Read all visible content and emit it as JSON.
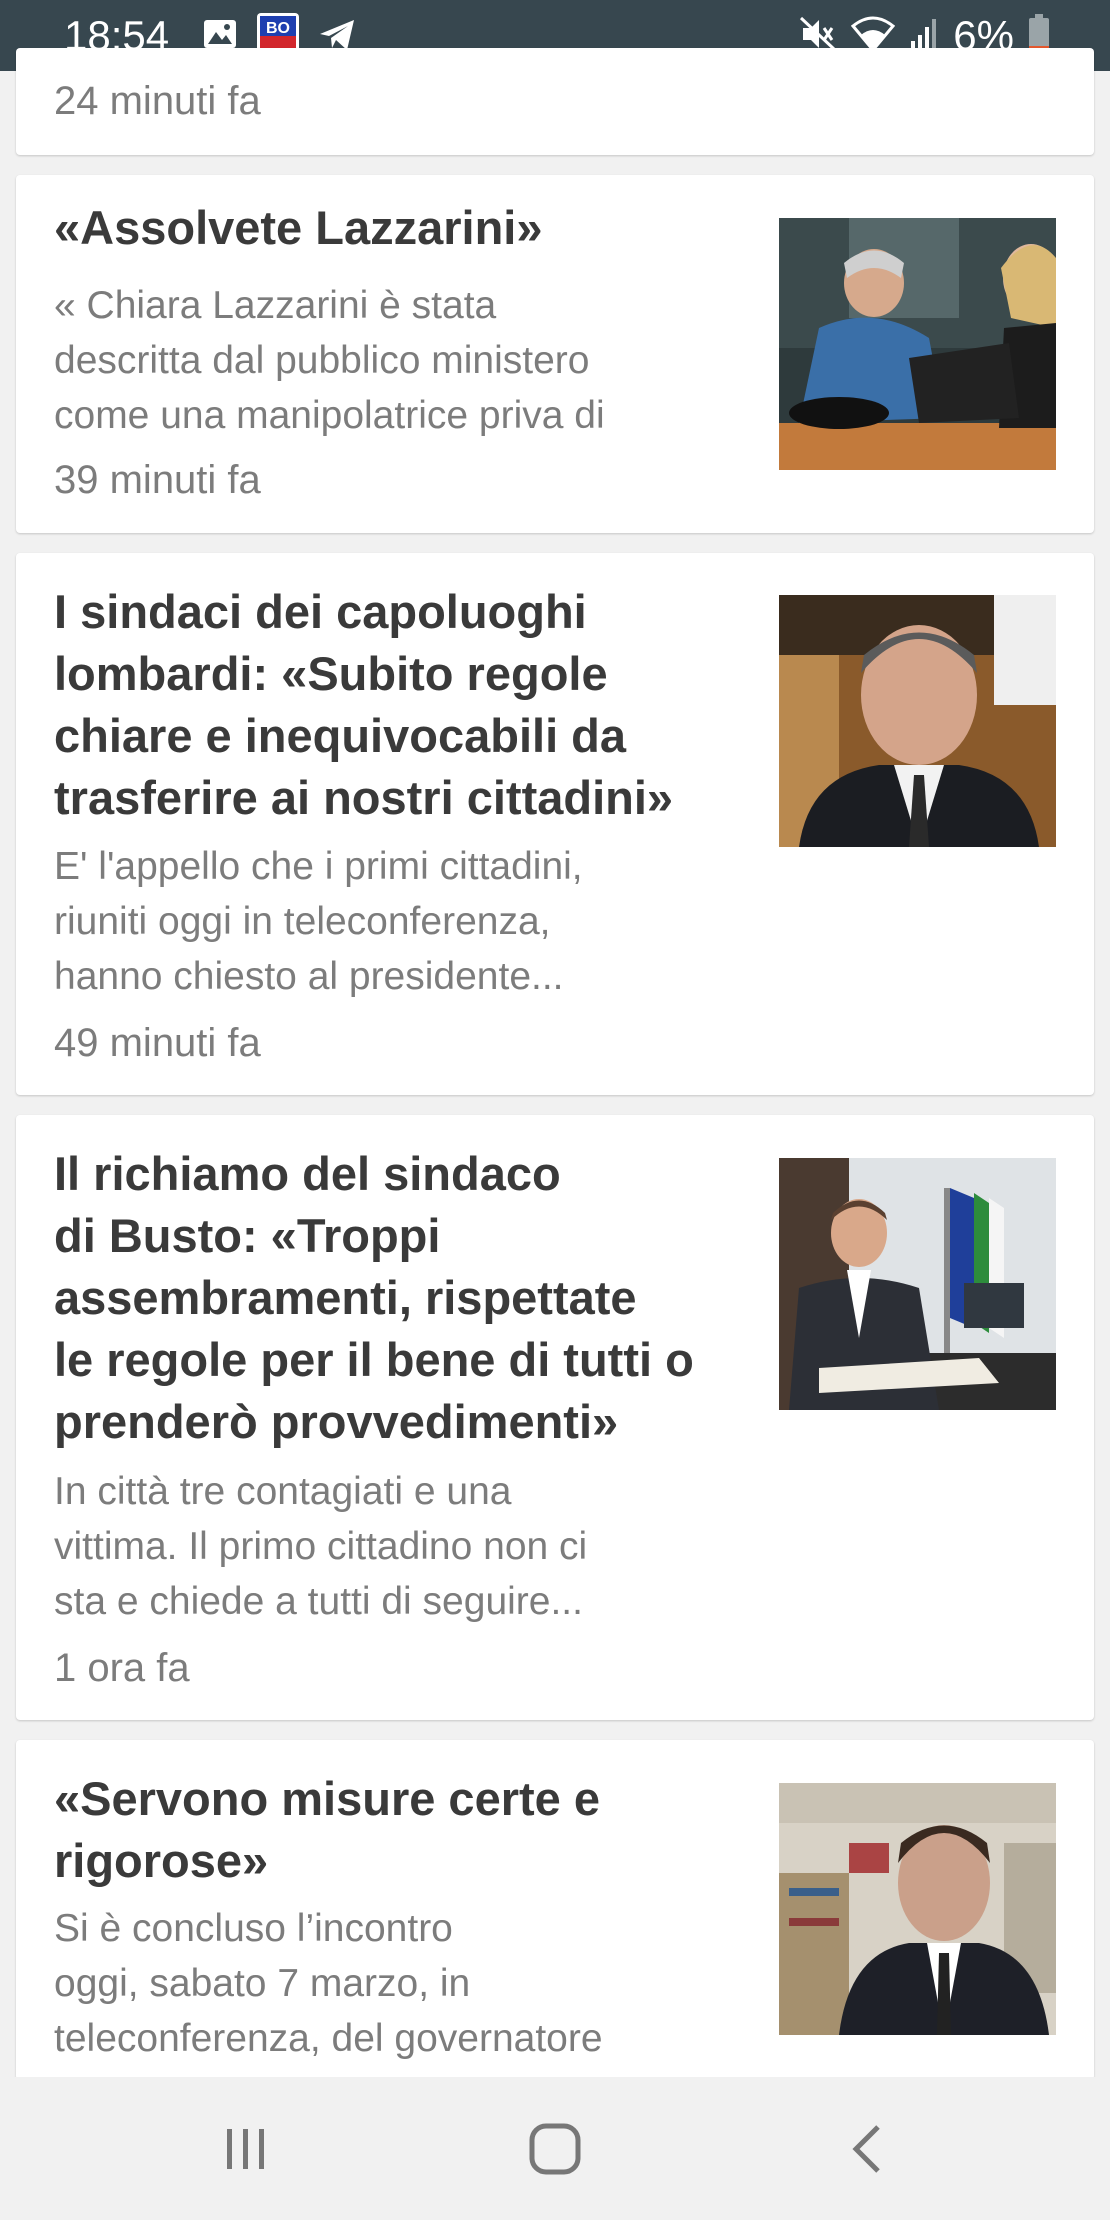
{
  "status_bar": {
    "time": "18:54",
    "battery_percent": "6%",
    "left_icons": [
      "gallery-icon",
      "app-badge-icon",
      "telegram-icon"
    ],
    "right_icons": [
      "mute-icon",
      "wifi-icon",
      "signal-icon",
      "battery-icon"
    ]
  },
  "top_card": {
    "time": "24 minuti fa"
  },
  "articles": [
    {
      "title": "«Assolvete Lazzarini»",
      "snippet": [
        "« Chiara Lazzarini è stata",
        "descritta dal pubblico ministero",
        "come una manipolatrice priva di"
      ],
      "time": "39 minuti fa"
    },
    {
      "title": [
        "I sindaci dei capoluoghi",
        "lombardi: «Subito regole",
        "chiare e inequivocabili da",
        "trasferire ai nostri cittadini»"
      ],
      "snippet": [
        "E' l'appello che i primi cittadini,",
        "riuniti oggi in teleconferenza,",
        "hanno chiesto al presidente..."
      ],
      "time": "49 minuti fa"
    },
    {
      "title": [
        "Il richiamo del sindaco",
        "di Busto: «Troppi",
        "assembramenti, rispettate",
        "le regole per il bene di tutti o",
        "prenderò provvedimenti»"
      ],
      "snippet": [
        "In città tre contagiati e una",
        "vittima. Il primo cittadino non ci",
        "sta e chiede a tutti di seguire..."
      ],
      "time": "1 ora fa"
    },
    {
      "title": [
        "«Servono misure certe e",
        "rigorose»"
      ],
      "snippet": [
        "Si è concluso l’incontro",
        "oggi, sabato 7 marzo, in",
        "teleconferenza, del governatore"
      ]
    }
  ],
  "nav_bar": {
    "buttons": [
      "recent-apps-icon",
      "home-icon",
      "back-icon"
    ]
  }
}
